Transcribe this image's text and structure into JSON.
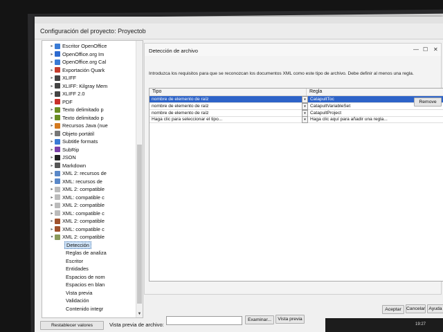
{
  "window": {
    "title": "Configuración del proyecto: Proyectob"
  },
  "tree": {
    "items": [
      {
        "label": "Escritor OpenOffice",
        "color": "#3a7bd5"
      },
      {
        "label": "OpenOffice.org Im",
        "color": "#2d6bd0"
      },
      {
        "label": "OpenOffice.org Cal",
        "color": "#3a7bd5"
      },
      {
        "label": "Exportación Quark",
        "color": "#c53c2c"
      },
      {
        "label": "XLIFF",
        "color": "#444444"
      },
      {
        "label": "XLIFF: Kilgray Mem",
        "color": "#444444"
      },
      {
        "label": "XLIFF 2.0",
        "color": "#444444"
      },
      {
        "label": "PDF",
        "color": "#c8302a"
      },
      {
        "label": "Texto delimitado p",
        "color": "#6b8e23"
      },
      {
        "label": "Texto delimitado p",
        "color": "#6b8e23"
      },
      {
        "label": "Recursos Java (nue",
        "color": "#d47a1f"
      },
      {
        "label": "Objeto portátil",
        "color": "#777777"
      },
      {
        "label": "Subtitle formats",
        "color": "#3a7bd5"
      },
      {
        "label": "SubRip",
        "color": "#7a3fa8"
      },
      {
        "label": "JSON",
        "color": "#222222"
      },
      {
        "label": "Markdown",
        "color": "#555555"
      },
      {
        "label": "XML 2: recursos de",
        "color": "#5a88c8"
      },
      {
        "label": "XML: recursos de",
        "color": "#5a88c8"
      },
      {
        "label": "XML 2: compatible",
        "color": "#bbbbbb"
      },
      {
        "label": "XML: compatible c",
        "color": "#bbbbbb"
      },
      {
        "label": "XML 2: compatible",
        "color": "#bbbbbb"
      },
      {
        "label": "XML: compatible c",
        "color": "#bbbbbb"
      },
      {
        "label": "XML 2: compatible",
        "color": "#a0522d"
      },
      {
        "label": "XML: compatible c",
        "color": "#a0522d"
      },
      {
        "label": "XML 2: compatible",
        "color": "#8a9a5b"
      }
    ],
    "children": [
      {
        "label": "Detección",
        "selected": true
      },
      {
        "label": "Reglas de analiza",
        "selected": false
      },
      {
        "label": "Escritor",
        "selected": false
      },
      {
        "label": "Entidades",
        "selected": false
      },
      {
        "label": "Espacios de nom",
        "selected": false
      },
      {
        "label": "Espacios en blan",
        "selected": false
      },
      {
        "label": "Vista previa",
        "selected": false
      },
      {
        "label": "Validación",
        "selected": false
      },
      {
        "label": "Contenido integr",
        "selected": false
      }
    ]
  },
  "panel": {
    "title": "Detección de archivo",
    "intro": "Introduzca los requisitos para que se reconozcan los documentos XML como este tipo de archivo. Debe definir al menos una regla.",
    "columns": {
      "type": "Tipo",
      "rule": "Regla"
    },
    "rows": [
      {
        "type": "nombre de elemento de raíz",
        "rule": "CatapultToc",
        "selected": true
      },
      {
        "type": "nombre de elemento de raíz",
        "rule": "CatapultVariableSet",
        "selected": false
      },
      {
        "type": "nombre de elemento de raíz",
        "rule": "CatapultProject",
        "selected": false
      },
      {
        "type": "Haga clic para seleccionar el tipo...",
        "rule": "Haga clic aquí para añadir una regla...",
        "selected": false
      }
    ],
    "remove_label": "Remove"
  },
  "footer": {
    "reset_label": "Restablecer valores",
    "preview_label": "Vista previa de archivo:",
    "browse_label": "Examinar...",
    "preview_button": "Vista previa",
    "ok_label": "Aceptar",
    "cancel_label": "Cancelar",
    "help_label": "Ayuda"
  },
  "clock": {
    "time": "19:27"
  }
}
